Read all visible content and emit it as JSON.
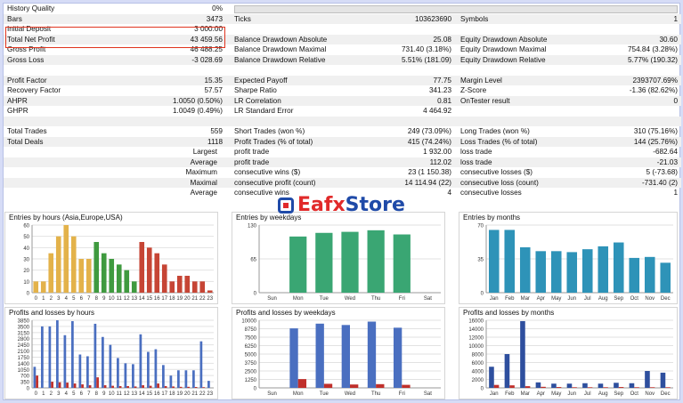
{
  "stats": {
    "history_quality": {
      "label": "History Quality",
      "value": "0%",
      "bar_fraction": 0.0
    },
    "rows": [
      {
        "l1": "Bars",
        "v1": "3473",
        "l2": "Ticks",
        "v2": "103623690",
        "l3": "Symbols",
        "v3": "1"
      },
      {
        "l1": "Initial Deposit",
        "v1": "3 000.00",
        "l2": "",
        "v2": "",
        "l3": "",
        "v3": ""
      },
      {
        "l1": "Total Net Profit",
        "v1": "43 459.56",
        "l2": "Balance Drawdown Absolute",
        "v2": "25.08",
        "l3": "Equity Drawdown Absolute",
        "v3": "30.60"
      },
      {
        "l1": "Gross Profit",
        "v1": "46 488.25",
        "l2": "Balance Drawdown Maximal",
        "v2": "731.40 (3.18%)",
        "l3": "Equity Drawdown Maximal",
        "v3": "754.84 (3.28%)"
      },
      {
        "l1": "Gross Loss",
        "v1": "-3 028.69",
        "l2": "Balance Drawdown Relative",
        "v2": "5.51% (181.09)",
        "l3": "Equity Drawdown Relative",
        "v3": "5.77% (190.32)"
      },
      {
        "l1": "",
        "v1": "",
        "l2": "",
        "v2": "",
        "l3": "",
        "v3": ""
      },
      {
        "l1": "Profit Factor",
        "v1": "15.35",
        "l2": "Expected Payoff",
        "v2": "77.75",
        "l3": "Margin Level",
        "v3": "2393707.69%"
      },
      {
        "l1": "Recovery Factor",
        "v1": "57.57",
        "l2": "Sharpe Ratio",
        "v2": "341.23",
        "l3": "Z-Score",
        "v3": "-1.36 (82.62%)"
      },
      {
        "l1": "AHPR",
        "v1": "1.0050 (0.50%)",
        "l2": "LR Correlation",
        "v2": "0.81",
        "l3": "OnTester result",
        "v3": "0"
      },
      {
        "l1": "GHPR",
        "v1": "1.0049 (0.49%)",
        "l2": "LR Standard Error",
        "v2": "4 464.92",
        "l3": "",
        "v3": ""
      },
      {
        "l1": "",
        "v1": "",
        "l2": "",
        "v2": "",
        "l3": "",
        "v3": ""
      },
      {
        "l1": "Total Trades",
        "v1": "559",
        "l2": "Short Trades (won %)",
        "v2": "249 (73.09%)",
        "l3": "Long Trades (won %)",
        "v3": "310 (75.16%)"
      },
      {
        "l1": "Total Deals",
        "v1": "1118",
        "l2": "Profit Trades (% of total)",
        "v2": "415 (74.24%)",
        "l3": "Loss Trades (% of total)",
        "v3": "144 (25.76%)"
      },
      {
        "l1": "Largest",
        "v1": "",
        "l2": "profit trade",
        "v2": "1 932.00",
        "l3": "loss trade",
        "v3": "-682.64",
        "right": true
      },
      {
        "l1": "Average",
        "v1": "",
        "l2": "profit trade",
        "v2": "112.02",
        "l3": "loss trade",
        "v3": "-21.03",
        "right": true
      },
      {
        "l1": "Maximum",
        "v1": "",
        "l2": "consecutive wins ($)",
        "v2": "23 (1 150.38)",
        "l3": "consecutive losses ($)",
        "v3": "5 (-73.68)",
        "right": true
      },
      {
        "l1": "Maximal",
        "v1": "",
        "l2": "consecutive profit (count)",
        "v2": "14 114.94 (22)",
        "l3": "consecutive loss (count)",
        "v3": "-731.40 (2)",
        "right": true
      },
      {
        "l1": "Average",
        "v1": "",
        "l2": "consecutive wins",
        "v2": "4",
        "l3": "consecutive losses",
        "v3": "1",
        "right": true
      }
    ]
  },
  "watermark": {
    "part_a": "Eafx",
    "part_b": "Store"
  },
  "colors": {
    "highlight_box": "#e0341e",
    "grid": "#e2e2e2",
    "axis_text": "#333333"
  },
  "chart_data": [
    {
      "type": "bar",
      "title": "Entries by hours (Asia,Europe,USA)",
      "categories": [
        "0",
        "1",
        "2",
        "3",
        "4",
        "5",
        "6",
        "7",
        "8",
        "9",
        "10",
        "11",
        "12",
        "13",
        "14",
        "15",
        "16",
        "17",
        "18",
        "19",
        "20",
        "21",
        "22",
        "23"
      ],
      "values": [
        10,
        10,
        35,
        50,
        60,
        50,
        30,
        30,
        45,
        35,
        30,
        25,
        20,
        10,
        45,
        40,
        35,
        25,
        10,
        15,
        15,
        10,
        10,
        2
      ],
      "bar_colors": [
        "#e3b24a",
        "#e3b24a",
        "#e3b24a",
        "#e3b24a",
        "#e3b24a",
        "#e3b24a",
        "#e3b24a",
        "#e3b24a",
        "#3f9a3f",
        "#3f9a3f",
        "#3f9a3f",
        "#3f9a3f",
        "#3f9a3f",
        "#3f9a3f",
        "#c64535",
        "#c64535",
        "#c64535",
        "#c64535",
        "#c64535",
        "#c64535",
        "#c64535",
        "#c64535",
        "#c64535",
        "#c64535"
      ],
      "ylim": [
        0,
        60
      ],
      "yticks": [
        0,
        10,
        20,
        30,
        40,
        50,
        60
      ]
    },
    {
      "type": "bar",
      "title": "Entries by weekdays",
      "categories": [
        "Sun",
        "Mon",
        "Tue",
        "Wed",
        "Thu",
        "Fri",
        "Sat"
      ],
      "values": [
        0,
        108,
        115,
        117,
        120,
        112,
        0
      ],
      "bar_colors": [
        "#3aa673",
        "#3aa673",
        "#3aa673",
        "#3aa673",
        "#3aa673",
        "#3aa673",
        "#3aa673"
      ],
      "ylim": [
        0,
        130
      ],
      "yticks": [
        0,
        65,
        130
      ]
    },
    {
      "type": "bar",
      "title": "Entries by months",
      "categories": [
        "Jan",
        "Feb",
        "Mar",
        "Apr",
        "May",
        "Jun",
        "Jul",
        "Aug",
        "Sep",
        "Oct",
        "Nov",
        "Dec"
      ],
      "values": [
        65,
        65,
        47,
        43,
        43,
        42,
        45,
        48,
        52,
        36,
        37,
        31
      ],
      "bar_colors": [
        "#2e93b8",
        "#2e93b8",
        "#2e93b8",
        "#2e93b8",
        "#2e93b8",
        "#2e93b8",
        "#2e93b8",
        "#2e93b8",
        "#2e93b8",
        "#2e93b8",
        "#2e93b8",
        "#2e93b8"
      ],
      "ylim": [
        0,
        70
      ],
      "yticks": [
        0,
        35,
        70
      ]
    },
    {
      "type": "bar",
      "title": "Profits and losses by hours",
      "categories": [
        "0",
        "1",
        "2",
        "3",
        "4",
        "5",
        "6",
        "7",
        "8",
        "9",
        "10",
        "11",
        "12",
        "13",
        "14",
        "15",
        "16",
        "17",
        "18",
        "19",
        "20",
        "21",
        "22",
        "23"
      ],
      "series": [
        {
          "values": [
            1200,
            3500,
            3500,
            3850,
            3000,
            3800,
            1900,
            1800,
            3650,
            2900,
            2450,
            1700,
            1400,
            1350,
            3050,
            2050,
            2200,
            1300,
            700,
            1000,
            1000,
            1000,
            2650,
            400
          ],
          "color": "#4a6fc0"
        },
        {
          "values": [
            700,
            0,
            350,
            320,
            300,
            250,
            200,
            150,
            600,
            150,
            120,
            100,
            100,
            80,
            150,
            120,
            250,
            100,
            80,
            60,
            60,
            50,
            40,
            0
          ],
          "color": "#c0302b"
        }
      ],
      "ylim": [
        0,
        3850
      ],
      "yticks": [
        0,
        350,
        700,
        1050,
        1400,
        1750,
        2100,
        2450,
        2800,
        3150,
        3500,
        3850
      ]
    },
    {
      "type": "bar",
      "title": "Profits and losses by weekdays",
      "categories": [
        "Sun",
        "Mon",
        "Tue",
        "Wed",
        "Thu",
        "Fri",
        "Sat"
      ],
      "series": [
        {
          "values": [
            0,
            8800,
            9500,
            9300,
            9800,
            8900,
            0
          ],
          "color": "#4a6fc0"
        },
        {
          "values": [
            0,
            1300,
            600,
            500,
            550,
            450,
            0
          ],
          "color": "#c0302b"
        }
      ],
      "ylim": [
        0,
        10000
      ],
      "yticks": [
        0,
        1250,
        2500,
        3750,
        5000,
        6250,
        7500,
        8750,
        10000
      ]
    },
    {
      "type": "bar",
      "title": "Profits and losses by months",
      "categories": [
        "Jan",
        "Feb",
        "Mar",
        "Apr",
        "May",
        "Jun",
        "Jul",
        "Aug",
        "Sep",
        "Oct",
        "Nov",
        "Dec"
      ],
      "series": [
        {
          "values": [
            5000,
            8000,
            15800,
            1300,
            1000,
            1000,
            1100,
            1000,
            1200,
            1100,
            4000,
            3600
          ],
          "color": "#2e4f9e"
        },
        {
          "values": [
            700,
            600,
            400,
            250,
            200,
            150,
            150,
            150,
            200,
            150,
            150,
            150
          ],
          "color": "#c0302b"
        }
      ],
      "ylim": [
        0,
        16000
      ],
      "yticks": [
        0,
        2000,
        4000,
        6000,
        8000,
        10000,
        12000,
        14000,
        16000
      ]
    }
  ]
}
